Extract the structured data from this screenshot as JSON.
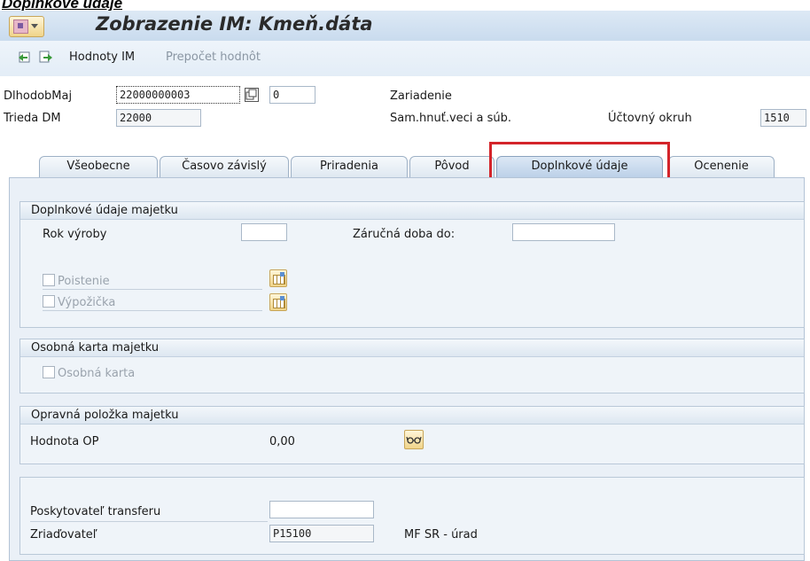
{
  "doc_heading": "Doplnkové údaje",
  "window": {
    "title": "Zobrazenie IM:  Kmeň.dáta"
  },
  "toolbar": {
    "prev_icon": "back-arrow-icon",
    "next_icon": "forward-arrow-icon",
    "hodnoty_label": "Hodnoty IM",
    "prepocet_label": "Prepočet hodnôt"
  },
  "header": {
    "asset_label": "DlhodobMaj",
    "asset_value": "22000000003",
    "sub_number": "0",
    "class_label": "Trieda DM",
    "class_value": "22000",
    "zariadenie_label": "Zariadenie",
    "description": "Sam.hnuť.veci a súb.",
    "company_code_label": "Účtovný okruh",
    "company_code_value": "1510"
  },
  "tabs": [
    {
      "label": "Všeobecne",
      "active": false
    },
    {
      "label": "Časovo závislý",
      "active": false
    },
    {
      "label": "Priradenia",
      "active": false
    },
    {
      "label": "Pôvod",
      "active": false
    },
    {
      "label": "Doplnkové údaje",
      "active": true
    },
    {
      "label": "Ocenenie",
      "active": false
    }
  ],
  "highlight_color": "#d4242a",
  "groups": {
    "additional": {
      "title": "Doplnkové údaje majetku",
      "rok_vyroby_label": "Rok výroby",
      "rok_vyroby_value": "",
      "zarucna_label": "Záručná doba do:",
      "zarucna_value": "",
      "poistenie_label": "Poistenie",
      "vypozicka_label": "Výpožička"
    },
    "personal": {
      "title": "Osobná karta majetku",
      "osobna_karta_label": "Osobná karta"
    },
    "correction": {
      "title": "Opravná položka majetku",
      "hodnota_label": "Hodnota OP",
      "hodnota_value": "0,00",
      "icon": "glasses-icon"
    },
    "transfer": {
      "poskytovatel_label": "Poskytovateľ transferu",
      "poskytovatel_value": "",
      "zriadovatel_label": "Zriaďovateľ",
      "zriadovatel_value": "P15100",
      "zriadovatel_desc": "MF SR - úrad"
    }
  }
}
